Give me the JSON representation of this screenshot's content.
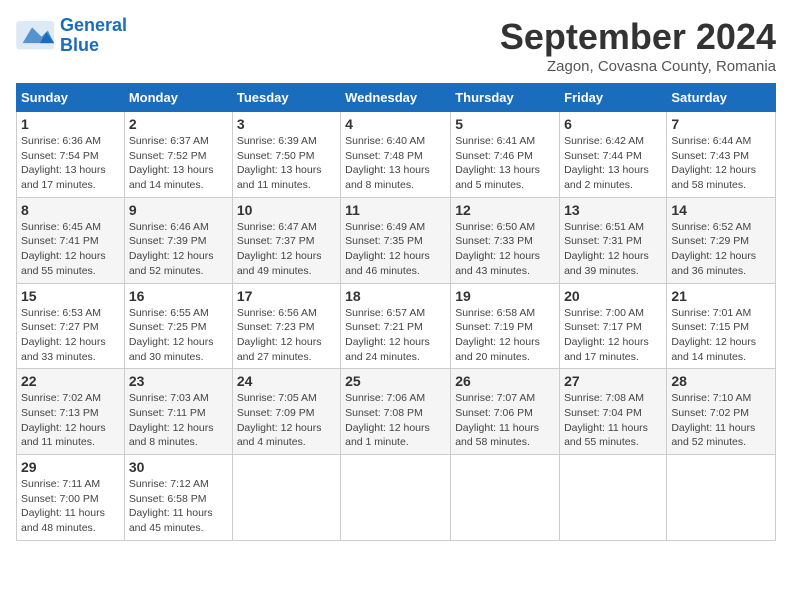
{
  "header": {
    "logo_line1": "General",
    "logo_line2": "Blue",
    "month_title": "September 2024",
    "subtitle": "Zagon, Covasna County, Romania"
  },
  "weekdays": [
    "Sunday",
    "Monday",
    "Tuesday",
    "Wednesday",
    "Thursday",
    "Friday",
    "Saturday"
  ],
  "weeks": [
    [
      {
        "day": "1",
        "info": "Sunrise: 6:36 AM\nSunset: 7:54 PM\nDaylight: 13 hours and 17 minutes."
      },
      {
        "day": "2",
        "info": "Sunrise: 6:37 AM\nSunset: 7:52 PM\nDaylight: 13 hours and 14 minutes."
      },
      {
        "day": "3",
        "info": "Sunrise: 6:39 AM\nSunset: 7:50 PM\nDaylight: 13 hours and 11 minutes."
      },
      {
        "day": "4",
        "info": "Sunrise: 6:40 AM\nSunset: 7:48 PM\nDaylight: 13 hours and 8 minutes."
      },
      {
        "day": "5",
        "info": "Sunrise: 6:41 AM\nSunset: 7:46 PM\nDaylight: 13 hours and 5 minutes."
      },
      {
        "day": "6",
        "info": "Sunrise: 6:42 AM\nSunset: 7:44 PM\nDaylight: 13 hours and 2 minutes."
      },
      {
        "day": "7",
        "info": "Sunrise: 6:44 AM\nSunset: 7:43 PM\nDaylight: 12 hours and 58 minutes."
      }
    ],
    [
      {
        "day": "8",
        "info": "Sunrise: 6:45 AM\nSunset: 7:41 PM\nDaylight: 12 hours and 55 minutes."
      },
      {
        "day": "9",
        "info": "Sunrise: 6:46 AM\nSunset: 7:39 PM\nDaylight: 12 hours and 52 minutes."
      },
      {
        "day": "10",
        "info": "Sunrise: 6:47 AM\nSunset: 7:37 PM\nDaylight: 12 hours and 49 minutes."
      },
      {
        "day": "11",
        "info": "Sunrise: 6:49 AM\nSunset: 7:35 PM\nDaylight: 12 hours and 46 minutes."
      },
      {
        "day": "12",
        "info": "Sunrise: 6:50 AM\nSunset: 7:33 PM\nDaylight: 12 hours and 43 minutes."
      },
      {
        "day": "13",
        "info": "Sunrise: 6:51 AM\nSunset: 7:31 PM\nDaylight: 12 hours and 39 minutes."
      },
      {
        "day": "14",
        "info": "Sunrise: 6:52 AM\nSunset: 7:29 PM\nDaylight: 12 hours and 36 minutes."
      }
    ],
    [
      {
        "day": "15",
        "info": "Sunrise: 6:53 AM\nSunset: 7:27 PM\nDaylight: 12 hours and 33 minutes."
      },
      {
        "day": "16",
        "info": "Sunrise: 6:55 AM\nSunset: 7:25 PM\nDaylight: 12 hours and 30 minutes."
      },
      {
        "day": "17",
        "info": "Sunrise: 6:56 AM\nSunset: 7:23 PM\nDaylight: 12 hours and 27 minutes."
      },
      {
        "day": "18",
        "info": "Sunrise: 6:57 AM\nSunset: 7:21 PM\nDaylight: 12 hours and 24 minutes."
      },
      {
        "day": "19",
        "info": "Sunrise: 6:58 AM\nSunset: 7:19 PM\nDaylight: 12 hours and 20 minutes."
      },
      {
        "day": "20",
        "info": "Sunrise: 7:00 AM\nSunset: 7:17 PM\nDaylight: 12 hours and 17 minutes."
      },
      {
        "day": "21",
        "info": "Sunrise: 7:01 AM\nSunset: 7:15 PM\nDaylight: 12 hours and 14 minutes."
      }
    ],
    [
      {
        "day": "22",
        "info": "Sunrise: 7:02 AM\nSunset: 7:13 PM\nDaylight: 12 hours and 11 minutes."
      },
      {
        "day": "23",
        "info": "Sunrise: 7:03 AM\nSunset: 7:11 PM\nDaylight: 12 hours and 8 minutes."
      },
      {
        "day": "24",
        "info": "Sunrise: 7:05 AM\nSunset: 7:09 PM\nDaylight: 12 hours and 4 minutes."
      },
      {
        "day": "25",
        "info": "Sunrise: 7:06 AM\nSunset: 7:08 PM\nDaylight: 12 hours and 1 minute."
      },
      {
        "day": "26",
        "info": "Sunrise: 7:07 AM\nSunset: 7:06 PM\nDaylight: 11 hours and 58 minutes."
      },
      {
        "day": "27",
        "info": "Sunrise: 7:08 AM\nSunset: 7:04 PM\nDaylight: 11 hours and 55 minutes."
      },
      {
        "day": "28",
        "info": "Sunrise: 7:10 AM\nSunset: 7:02 PM\nDaylight: 11 hours and 52 minutes."
      }
    ],
    [
      {
        "day": "29",
        "info": "Sunrise: 7:11 AM\nSunset: 7:00 PM\nDaylight: 11 hours and 48 minutes."
      },
      {
        "day": "30",
        "info": "Sunrise: 7:12 AM\nSunset: 6:58 PM\nDaylight: 11 hours and 45 minutes."
      },
      {
        "day": "",
        "info": ""
      },
      {
        "day": "",
        "info": ""
      },
      {
        "day": "",
        "info": ""
      },
      {
        "day": "",
        "info": ""
      },
      {
        "day": "",
        "info": ""
      }
    ]
  ]
}
